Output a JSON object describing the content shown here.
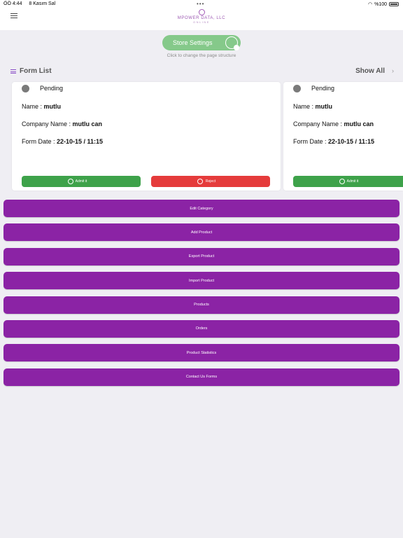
{
  "status_bar": {
    "time": "ÖÖ 4:44",
    "date": "8 Kasım Sal",
    "dots": "•••",
    "battery": "%100"
  },
  "header": {
    "logo_text": "MPOWER DATA, LLC",
    "logo_sub": "ONLINE",
    "menu_icon": "hamburger-icon"
  },
  "store": {
    "button_label": "Store Settings",
    "hint": "Click to change the page structure",
    "color": "#85c98a"
  },
  "form_list": {
    "title": "Form List",
    "show_all": "Show All",
    "chevron": "›",
    "cards": [
      {
        "status": "Pending",
        "name_label": "Name : ",
        "name": "mutlu",
        "company_label": "Company Name : ",
        "company": "mutlu can",
        "date_label": "Form Date : ",
        "date": "22-10-15 / 11:15",
        "admit_label": "Admit it",
        "reject_label": "Reject"
      },
      {
        "status": "Pending",
        "name_label": "Name : ",
        "name": "mutlu",
        "company_label": "Company Name : ",
        "company": "mutlu can",
        "date_label": "Form Date : ",
        "date": "22-10-15 / 11:15",
        "admit_label": "Admit it"
      }
    ]
  },
  "actions": [
    "Edit Category",
    "Add Product",
    "Export Product",
    "Import Product",
    "Products",
    "Orders",
    "Product Statistics",
    "Contact Us Forms"
  ],
  "colors": {
    "accent": "#8b23a5",
    "admit": "#3ea24a",
    "reject": "#e53b3b",
    "background": "#efeef3"
  }
}
